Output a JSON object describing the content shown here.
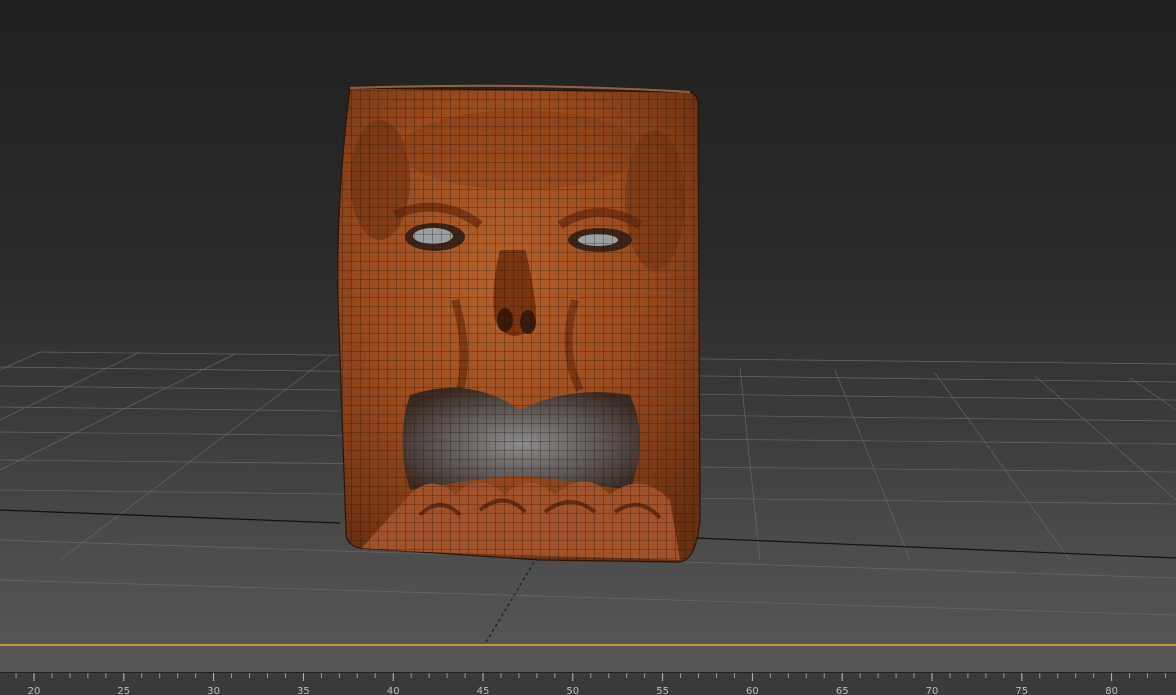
{
  "viewport": {
    "object": "book-face-model",
    "shading": "realistic-with-edged-faces",
    "accent_color": "#c9962f",
    "grid_color": "#6a6a6a",
    "model_color": "#9c4a1f"
  },
  "timeline": {
    "tick_labels": [
      "20",
      "25",
      "30",
      "35",
      "40",
      "45",
      "50",
      "55",
      "60",
      "65",
      "70",
      "75",
      "80"
    ],
    "minor_ticks_per_major": 5
  }
}
